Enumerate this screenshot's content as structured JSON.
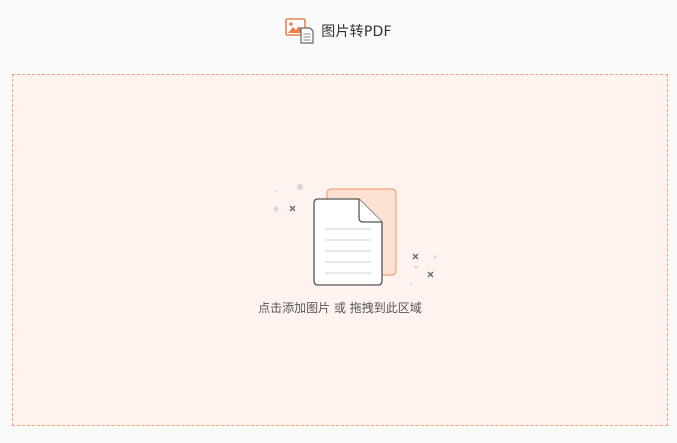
{
  "header": {
    "title": "图片转PDF",
    "icon": "image-to-pdf-icon"
  },
  "dropzone": {
    "hint": "点击添加图片 或 拖拽到此区域",
    "illustration_icon": "document-upload-icon"
  },
  "colors": {
    "accent": "#f0a17a",
    "dropzone_background": "#fff3ef",
    "page_background": "#fafafa",
    "title_text": "#333333",
    "hint_text": "#555555"
  }
}
